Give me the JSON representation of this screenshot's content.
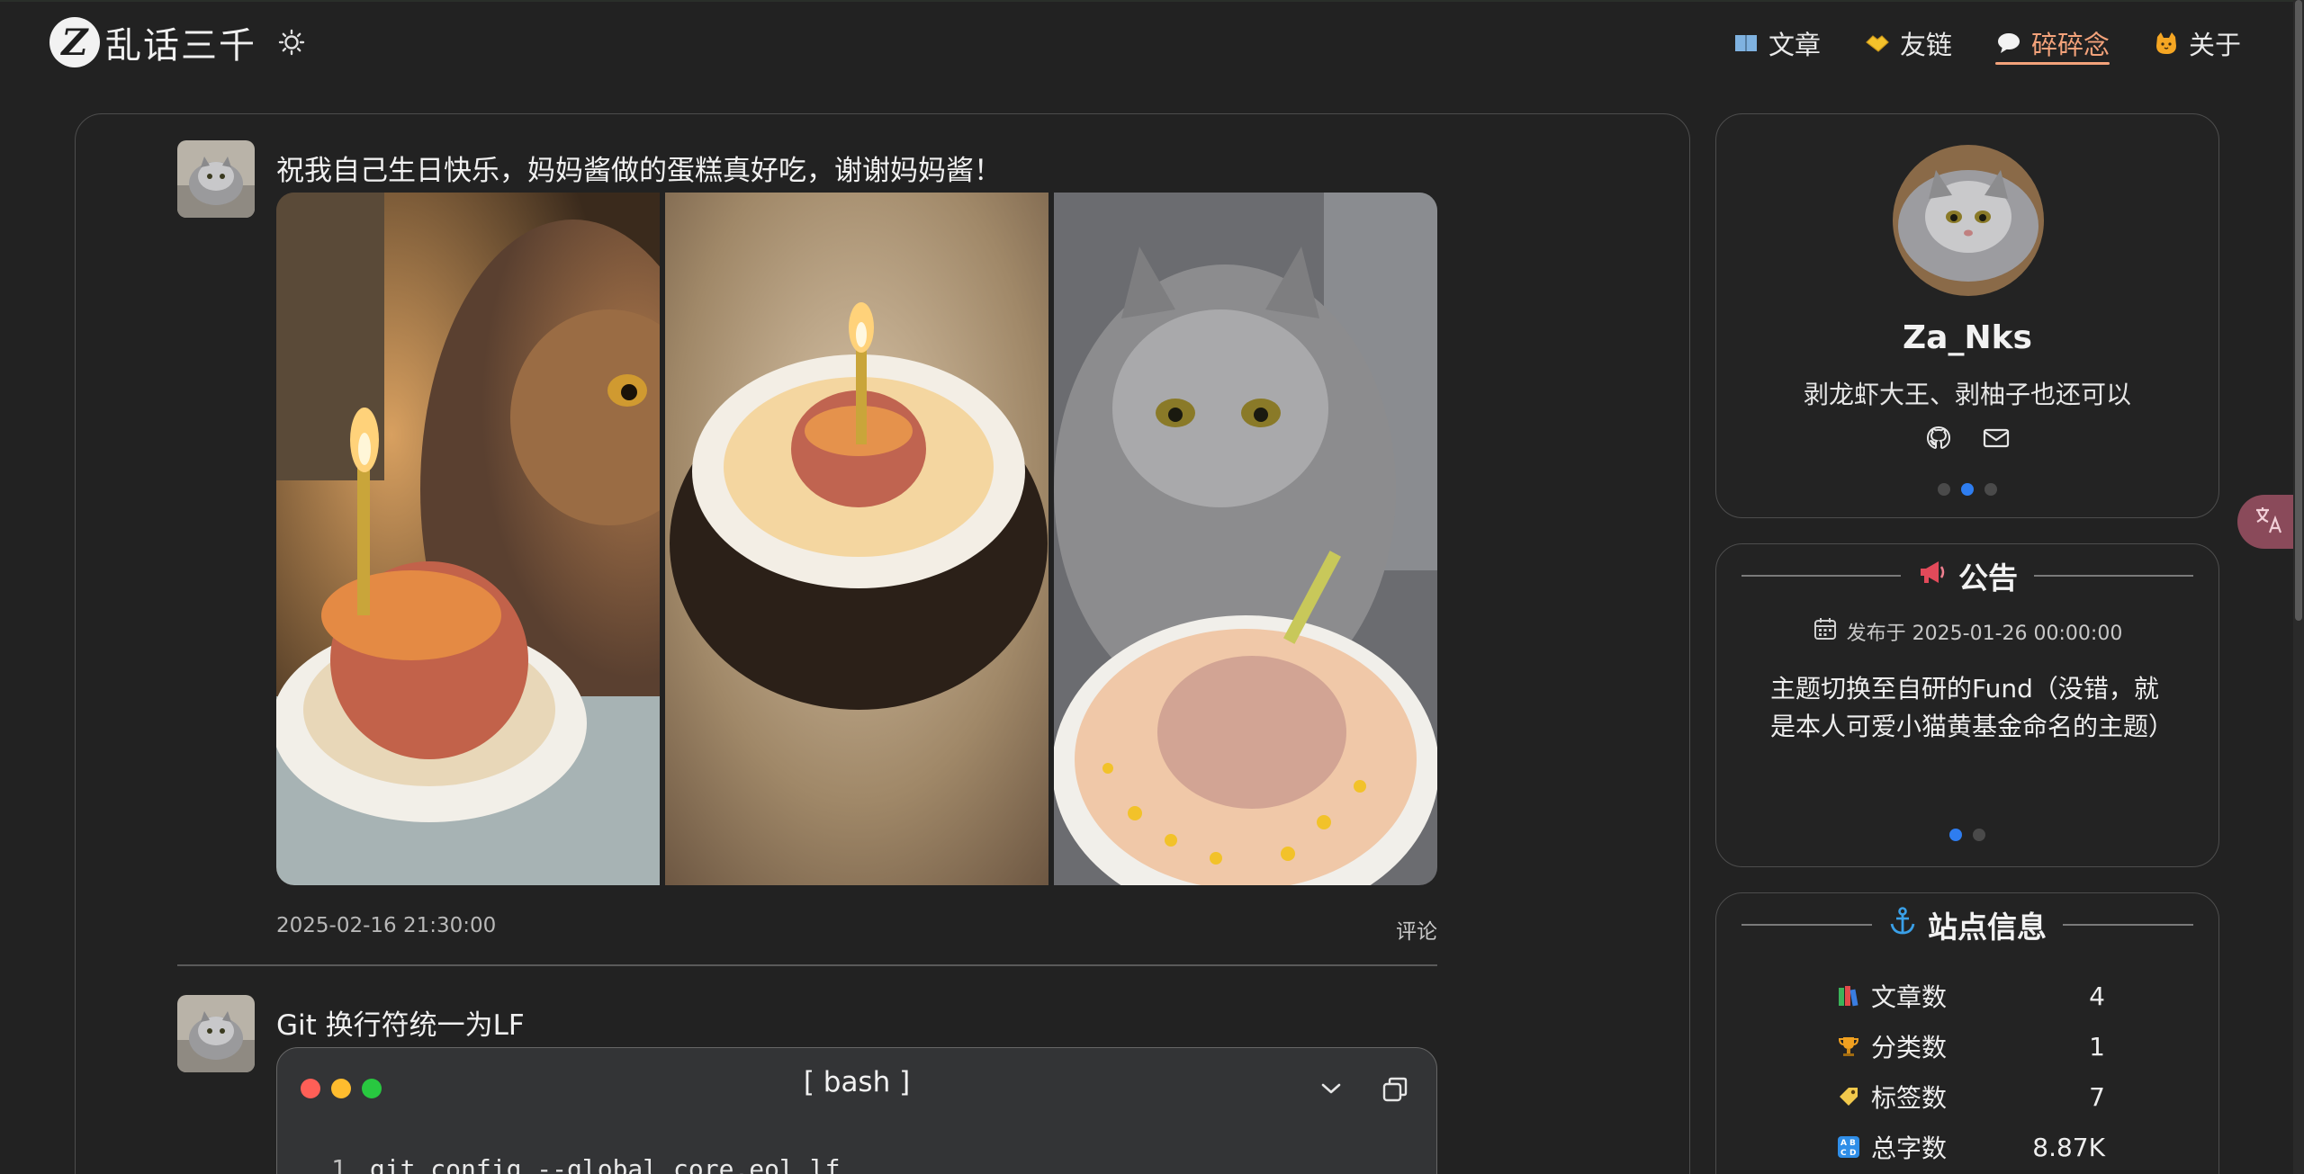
{
  "header": {
    "logo_letter": "Z",
    "site_title": "乱话三千",
    "nav": [
      {
        "label": "文章",
        "icon": "book-icon"
      },
      {
        "label": "友链",
        "icon": "handshake-icon"
      },
      {
        "label": "碎碎念",
        "icon": "speech-bubble-icon",
        "active": true
      },
      {
        "label": "关于",
        "icon": "cat-face-icon"
      }
    ],
    "accent_color": "#f3a27a"
  },
  "posts": [
    {
      "text": "祝我自己生日快乐，妈妈酱做的蛋糕真好吃，谢谢妈妈酱！",
      "photos": [
        "cat-and-cake-photo",
        "candle-cake-photo",
        "grey-cat-cake-photo"
      ],
      "date": "2025-02-16 21:30:00",
      "comment_label": "评论"
    },
    {
      "text": "Git 换行符统一为LF",
      "code": {
        "lang": "[ bash ]",
        "line_no": "1",
        "line": "git config --global core.eol lf"
      }
    }
  ],
  "profile": {
    "name": "Za_Nks",
    "bio": "剥龙虾大王、剥柚子也还可以",
    "links": [
      "github-icon",
      "mail-icon"
    ],
    "active_dot": 1
  },
  "notice": {
    "title": "公告",
    "date": "发布于 2025-01-26 00:00:00",
    "body": "主题切换至自研的Fund（没错，就是本人可爱小猫黄基金命名的主题）",
    "active_dot": 0
  },
  "site_info": {
    "title": "站点信息",
    "stats": [
      {
        "label": "文章数",
        "value": "4",
        "icon": "books-icon"
      },
      {
        "label": "分类数",
        "value": "1",
        "icon": "trophy-icon"
      },
      {
        "label": "标签数",
        "value": "7",
        "icon": "tag-icon"
      },
      {
        "label": "总字数",
        "value": "8.87K",
        "icon": "abcd-icon"
      }
    ]
  },
  "colors": {
    "background": "#222222",
    "dot_active": "#2e7df0",
    "anchor": "#3aa0e8"
  }
}
